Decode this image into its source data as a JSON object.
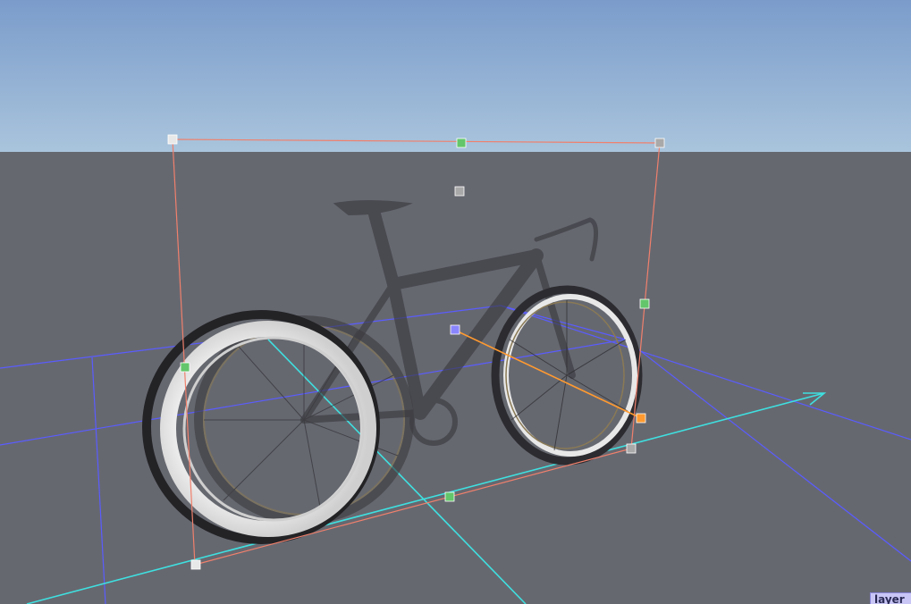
{
  "viewport": {
    "sky_top_color": "#7fa0cc",
    "sky_bottom_color": "#aac4dc",
    "ground_color": "#666870",
    "layer_tab_label": "layer"
  },
  "scene": {
    "object": "bicycle-model",
    "gizmo_colors": {
      "bounding_box": "#f0806c",
      "grid": "#5a5cff",
      "axis": "#3fe0e0",
      "handle_scale": "#63c66a",
      "handle_corner": "#a9a9a9",
      "handle_move": "#8a86ff",
      "handle_rotate": "#ff9a30"
    }
  }
}
